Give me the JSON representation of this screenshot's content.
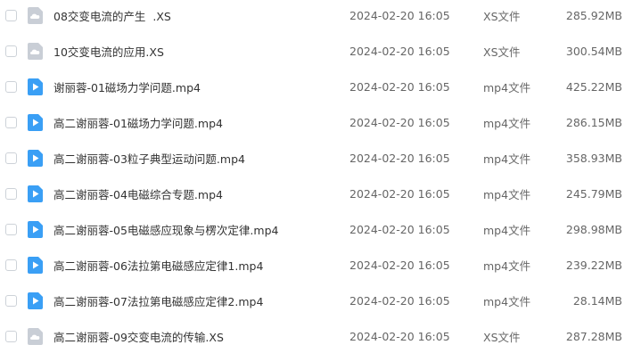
{
  "colors": {
    "video_icon": "#3a9ff5",
    "doc_icon": "#c9ced6",
    "text": "#333333",
    "meta_text": "#666666"
  },
  "files": [
    {
      "name": "08交变电流的产生  .XS",
      "date": "2024-02-20 16:05",
      "type": "XS文件",
      "size": "285.92MB",
      "icon": "cloud-doc-icon"
    },
    {
      "name": "10交变电流的应用.XS",
      "date": "2024-02-20 16:05",
      "type": "XS文件",
      "size": "300.54MB",
      "icon": "cloud-doc-icon"
    },
    {
      "name": "谢丽蓉-01磁场力学问题.mp4",
      "date": "2024-02-20 16:05",
      "type": "mp4文件",
      "size": "425.22MB",
      "icon": "video-icon"
    },
    {
      "name": "高二谢丽蓉-01磁场力学问题.mp4",
      "date": "2024-02-20 16:05",
      "type": "mp4文件",
      "size": "286.15MB",
      "icon": "video-icon"
    },
    {
      "name": "高二谢丽蓉-03粒子典型运动问题.mp4",
      "date": "2024-02-20 16:05",
      "type": "mp4文件",
      "size": "358.93MB",
      "icon": "video-icon"
    },
    {
      "name": "高二谢丽蓉-04电磁综合专题.mp4",
      "date": "2024-02-20 16:05",
      "type": "mp4文件",
      "size": "245.79MB",
      "icon": "video-icon"
    },
    {
      "name": "高二谢丽蓉-05电磁感应现象与楞次定律.mp4",
      "date": "2024-02-20 16:05",
      "type": "mp4文件",
      "size": "298.98MB",
      "icon": "video-icon"
    },
    {
      "name": "高二谢丽蓉-06法拉第电磁感应定律1.mp4",
      "date": "2024-02-20 16:05",
      "type": "mp4文件",
      "size": "239.22MB",
      "icon": "video-icon"
    },
    {
      "name": "高二谢丽蓉-07法拉第电磁感应定律2.mp4",
      "date": "2024-02-20 16:05",
      "type": "mp4文件",
      "size": "28.14MB",
      "icon": "video-icon"
    },
    {
      "name": "高二谢丽蓉-09交变电流的传输.XS",
      "date": "2024-02-20 16:05",
      "type": "XS文件",
      "size": "287.28MB",
      "icon": "cloud-doc-icon"
    }
  ]
}
